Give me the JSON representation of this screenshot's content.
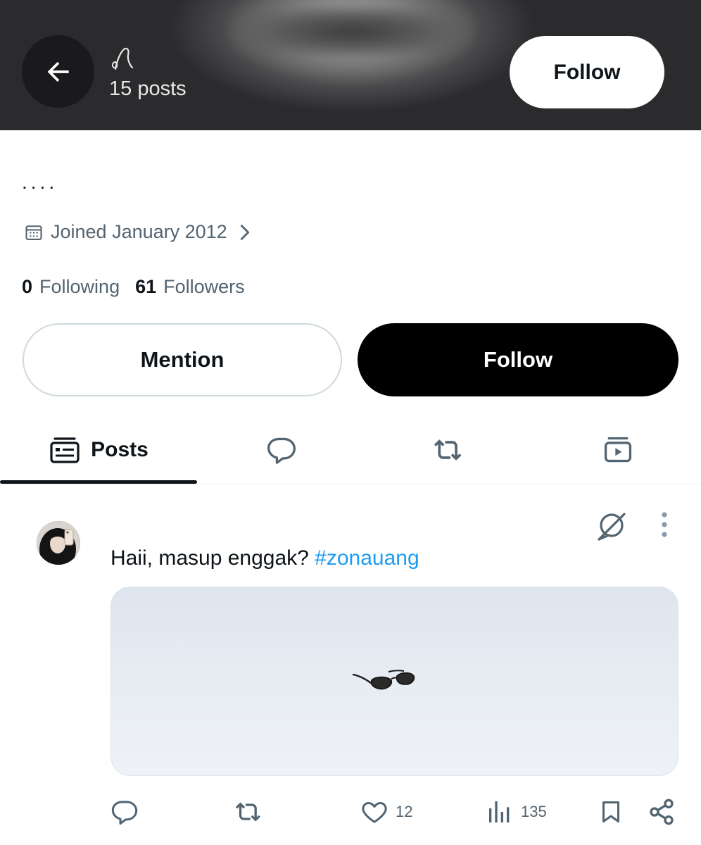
{
  "header": {
    "back_label": "Back",
    "posts_count": "15 posts",
    "follow_label": "Follow"
  },
  "profile": {
    "bio": "....",
    "joined": "Joined January 2012",
    "following_count": "0",
    "following_label": "Following",
    "followers_count": "61",
    "followers_label": "Followers",
    "mention_label": "Mention",
    "follow_label": "Follow"
  },
  "tabs": [
    {
      "label": "Posts",
      "icon": "posts-icon",
      "active": true
    },
    {
      "label": "",
      "icon": "replies-icon",
      "active": false
    },
    {
      "label": "",
      "icon": "reposts-icon",
      "active": false
    },
    {
      "label": "",
      "icon": "media-icon",
      "active": false
    }
  ],
  "post": {
    "text": "Haii, masup enggak? ",
    "hashtag": "#zonauang",
    "likes": "12",
    "views": "135"
  },
  "colors": {
    "accent": "#1d9bf0",
    "text_primary": "#0f1419",
    "text_secondary": "#536471",
    "border": "#cfd9de"
  }
}
